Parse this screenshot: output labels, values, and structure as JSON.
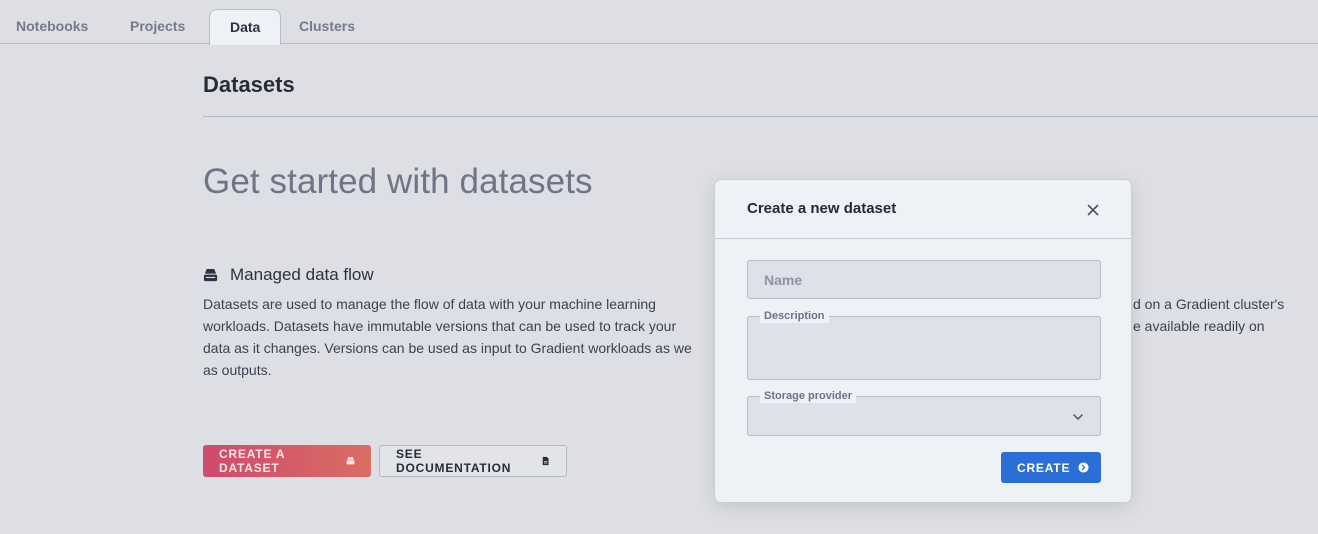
{
  "tabs": [
    {
      "label": "Notebooks"
    },
    {
      "label": "Projects"
    },
    {
      "label": "Data"
    },
    {
      "label": "Clusters"
    }
  ],
  "page": {
    "title": "Datasets",
    "hero": "Get started with datasets",
    "section_title": "Managed data flow",
    "section_icon": "stack-icon",
    "paragraph_lines": [
      "Datasets are used to manage the flow of data with your machine learning",
      "workloads. Datasets have immutable versions that can be used to track your",
      "data as it changes. Versions can be used as input to Gradient workloads as we",
      "as outputs."
    ],
    "right_lines": [
      "d on a Gradient cluster's",
      "e available readily on"
    ],
    "create_button": "CREATE A DATASET",
    "docs_button": "SEE DOCUMENTATION"
  },
  "modal": {
    "title": "Create a new dataset",
    "name_placeholder": "Name",
    "description_label": "Description",
    "storage_label": "Storage provider",
    "storage_value": "",
    "create_label": "CREATE"
  },
  "colors": {
    "accent_gradient": [
      "#cf4a6f",
      "#d96d62"
    ],
    "primary_blue": "#2b6fd6"
  }
}
